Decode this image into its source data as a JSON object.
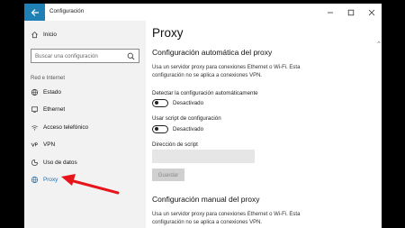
{
  "window": {
    "title": "Configuración",
    "back_icon": "back-arrow-icon",
    "controls": [
      "minimize-icon",
      "maximize-icon",
      "close-icon"
    ]
  },
  "sidebar": {
    "home_label": "Inicio",
    "search_placeholder": "Buscar una configuración",
    "section_header": "Red e Internet",
    "items": [
      {
        "label": "Estado",
        "icon": "globe-status-icon"
      },
      {
        "label": "Ethernet",
        "icon": "monitor-icon"
      },
      {
        "label": "Acceso telefónico",
        "icon": "dial-up-icon"
      },
      {
        "label": "VPN",
        "icon": "vpn-icon"
      },
      {
        "label": "Uso de datos",
        "icon": "data-usage-icon"
      },
      {
        "label": "Proxy",
        "icon": "globe-icon",
        "active": true
      }
    ]
  },
  "main": {
    "page_title": "Proxy",
    "auto_section": {
      "title": "Configuración automática del proxy",
      "description_line1": "Usa un servidor proxy para conexiones Ethernet o Wi-Fi. Esta",
      "description_line2": "configuración no se aplica a conexiones VPN.",
      "detect_label": "Detectar la configuración automáticamente",
      "detect_state": "Desactivado",
      "script_label": "Usar script de configuración",
      "script_state": "Desactivado",
      "address_label": "Dirección de script",
      "address_value": "",
      "save_label": "Guardar"
    },
    "manual_section": {
      "title": "Configuración manual del proxy",
      "description_line1": "Usa un servidor proxy para conexiones Ethernet o Wi-Fi. Esta",
      "description_line2": "configuración no se aplica a conexiones VPN."
    }
  },
  "colors": {
    "accent": "#1f80b5",
    "active_text": "#1f6fb0",
    "annotation_arrow": "#e8141b"
  }
}
